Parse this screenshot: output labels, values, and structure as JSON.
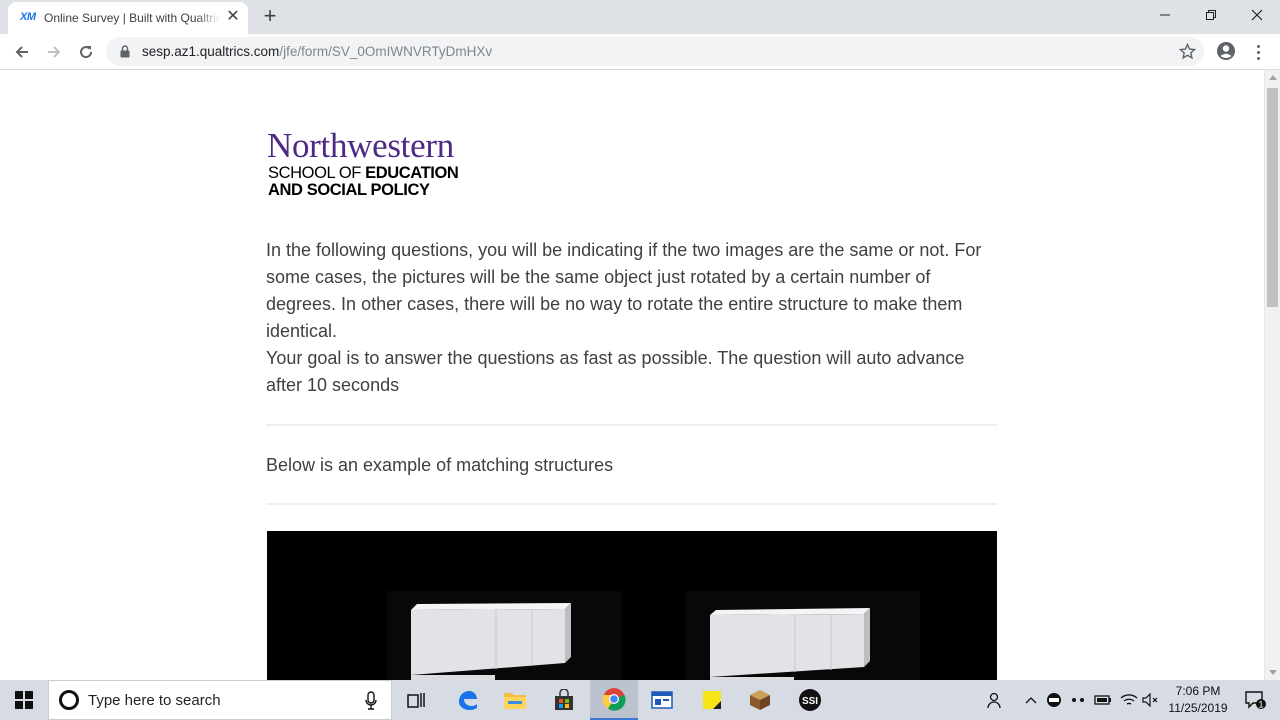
{
  "browser": {
    "tab": {
      "favicon_text": "XM",
      "title": "Online Survey | Built with Qualtrics Experience Management"
    },
    "address": {
      "host": "sesp.az1.qualtrics.com",
      "path": "/jfe/form/SV_0OmIWNVRTyDmHXv"
    }
  },
  "page": {
    "logo": {
      "name": "Northwestern",
      "school_line1_a": "SCHOOL OF ",
      "school_line1_b": "EDUCATION",
      "school_line2": "AND SOCIAL POLICY",
      "brand_color": "#4e2a84"
    },
    "intro_paragraph": "In the following questions, you will be indicating if the two images are the same or not. For some cases, the pictures will be the same object just rotated by a certain number of degrees. In other cases, there will be no way to rotate the entire structure to make them identical.",
    "intro_goal": "Your goal is to answer the questions as fast as possible. The question will auto advance after 10 seconds",
    "example_label": "Below is an example of matching structures"
  },
  "taskbar": {
    "search_placeholder": "Type here to search",
    "clock_time": "7:06 PM",
    "clock_date": "11/25/2019",
    "notification_count": "1",
    "apps": [
      "task-view",
      "edge",
      "file-explorer",
      "store",
      "chrome",
      "app",
      "sticky-notes",
      "minecraft",
      "ssi"
    ]
  }
}
